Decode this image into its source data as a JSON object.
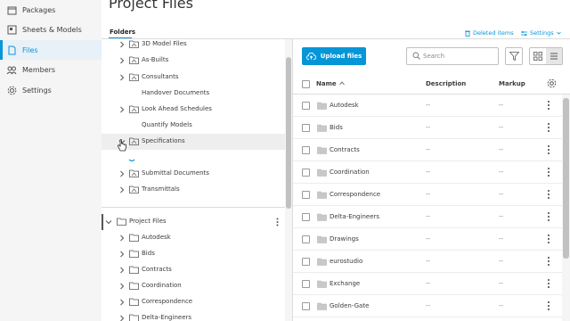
{
  "nav": {
    "items": [
      {
        "label": "Packages",
        "icon": "package-icon"
      },
      {
        "label": "Sheets & Models",
        "icon": "sheets-icon"
      },
      {
        "label": "Files",
        "icon": "file-icon",
        "active": true
      },
      {
        "label": "Members",
        "icon": "members-icon"
      },
      {
        "label": "Settings",
        "icon": "gear-icon"
      }
    ]
  },
  "header": {
    "title": "Project Files",
    "folders_tab": "Folders",
    "deleted_items": "Deleted items",
    "settings": "Settings"
  },
  "tree": {
    "items": [
      {
        "name": "3D Model Files",
        "expandable": true
      },
      {
        "name": "As-Builts",
        "expandable": true
      },
      {
        "name": "Consultants",
        "expandable": true
      },
      {
        "name": "Handover Documents",
        "expandable": false
      },
      {
        "name": "Look Ahead Schedules",
        "expandable": true
      },
      {
        "name": "Quantify Models",
        "expandable": false
      },
      {
        "name": "Specifications",
        "expandable": true,
        "expanded": true
      },
      {
        "name": "Submittal Documents",
        "expandable": true
      },
      {
        "name": "Transmittals",
        "expandable": true
      }
    ],
    "project_root": "Project Files",
    "project_items": [
      "Autodesk",
      "Bids",
      "Contracts",
      "Coordination",
      "Correspondence",
      "Delta-Engineers"
    ]
  },
  "toolbar": {
    "upload_label": "Upload files",
    "search_placeholder": "Search"
  },
  "table": {
    "columns": {
      "name": "Name",
      "description": "Description",
      "markup": "Markup"
    },
    "rows": [
      {
        "name": "Autodesk",
        "description": "--",
        "markup": "--"
      },
      {
        "name": "Bids",
        "description": "--",
        "markup": "--"
      },
      {
        "name": "Contracts",
        "description": "--",
        "markup": "--"
      },
      {
        "name": "Coordination",
        "description": "--",
        "markup": "--"
      },
      {
        "name": "Correspondence",
        "description": "--",
        "markup": "--"
      },
      {
        "name": "Delta-Engineers",
        "description": "--",
        "markup": "--"
      },
      {
        "name": "Drawings",
        "description": "--",
        "markup": "--"
      },
      {
        "name": "eurostudio",
        "description": "--",
        "markup": "--"
      },
      {
        "name": "Exchange",
        "description": "--",
        "markup": "--"
      },
      {
        "name": "Golden-Gate",
        "description": "--",
        "markup": "--"
      }
    ]
  },
  "colors": {
    "accent": "#0696d7",
    "nav_bg": "#f5f5f5"
  }
}
